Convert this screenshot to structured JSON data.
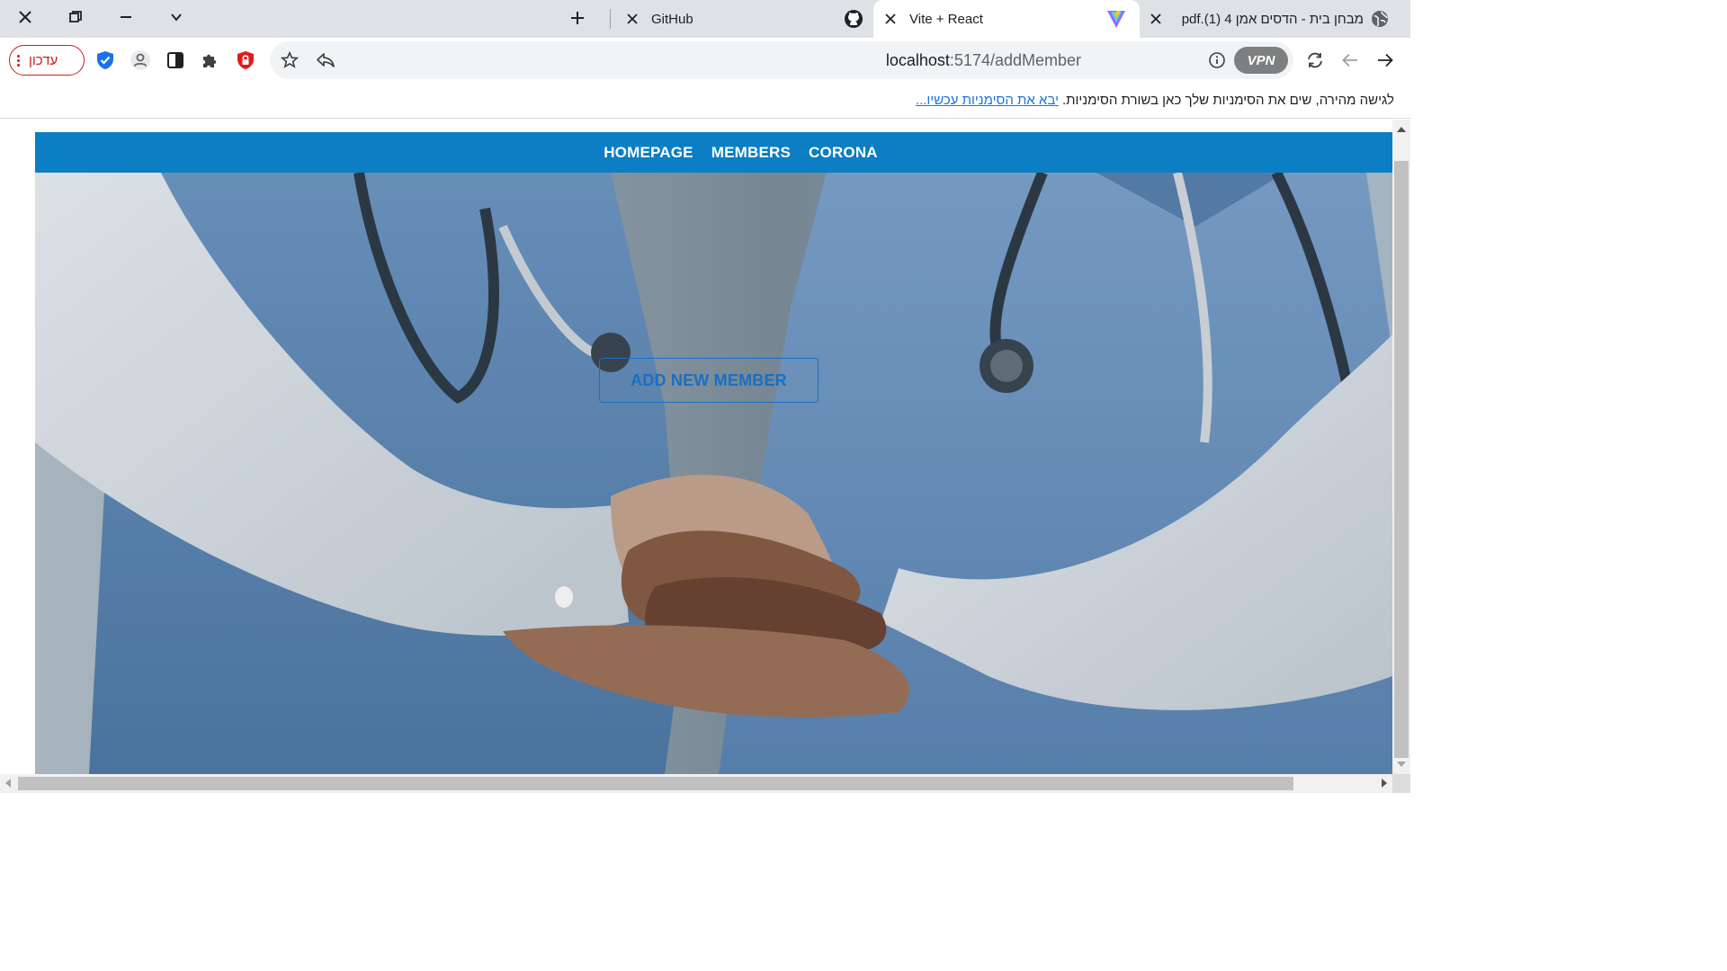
{
  "browser": {
    "tabs": [
      {
        "title": "GitHub",
        "favicon": "github-icon",
        "active": false
      },
      {
        "title": "Vite + React",
        "favicon": "vite-icon",
        "active": true
      },
      {
        "title": "מבחן בית - הדסים אמן 4 (1).pdf",
        "favicon": "globe-icon",
        "active": false
      }
    ],
    "url_host": "localhost",
    "url_path": ":5174/addMember",
    "update_label": "עדכון",
    "vpn_label": "VPN"
  },
  "bookmarks_bar": {
    "message": "לגישה מהירה, שים את הסימניות שלך כאן בשורת הסימניות.",
    "import_link": "יבא את הסימניות עכשיו..."
  },
  "page": {
    "nav": [
      "HOMEPAGE",
      "MEMBERS",
      "CORONA"
    ],
    "cta_label": "ADD NEW MEMBER"
  },
  "colors": {
    "navbar": "#0b7ec4",
    "cta": "#1a6fc4",
    "update_accent": "#c5221f",
    "tabstrip": "#dee1e6"
  }
}
